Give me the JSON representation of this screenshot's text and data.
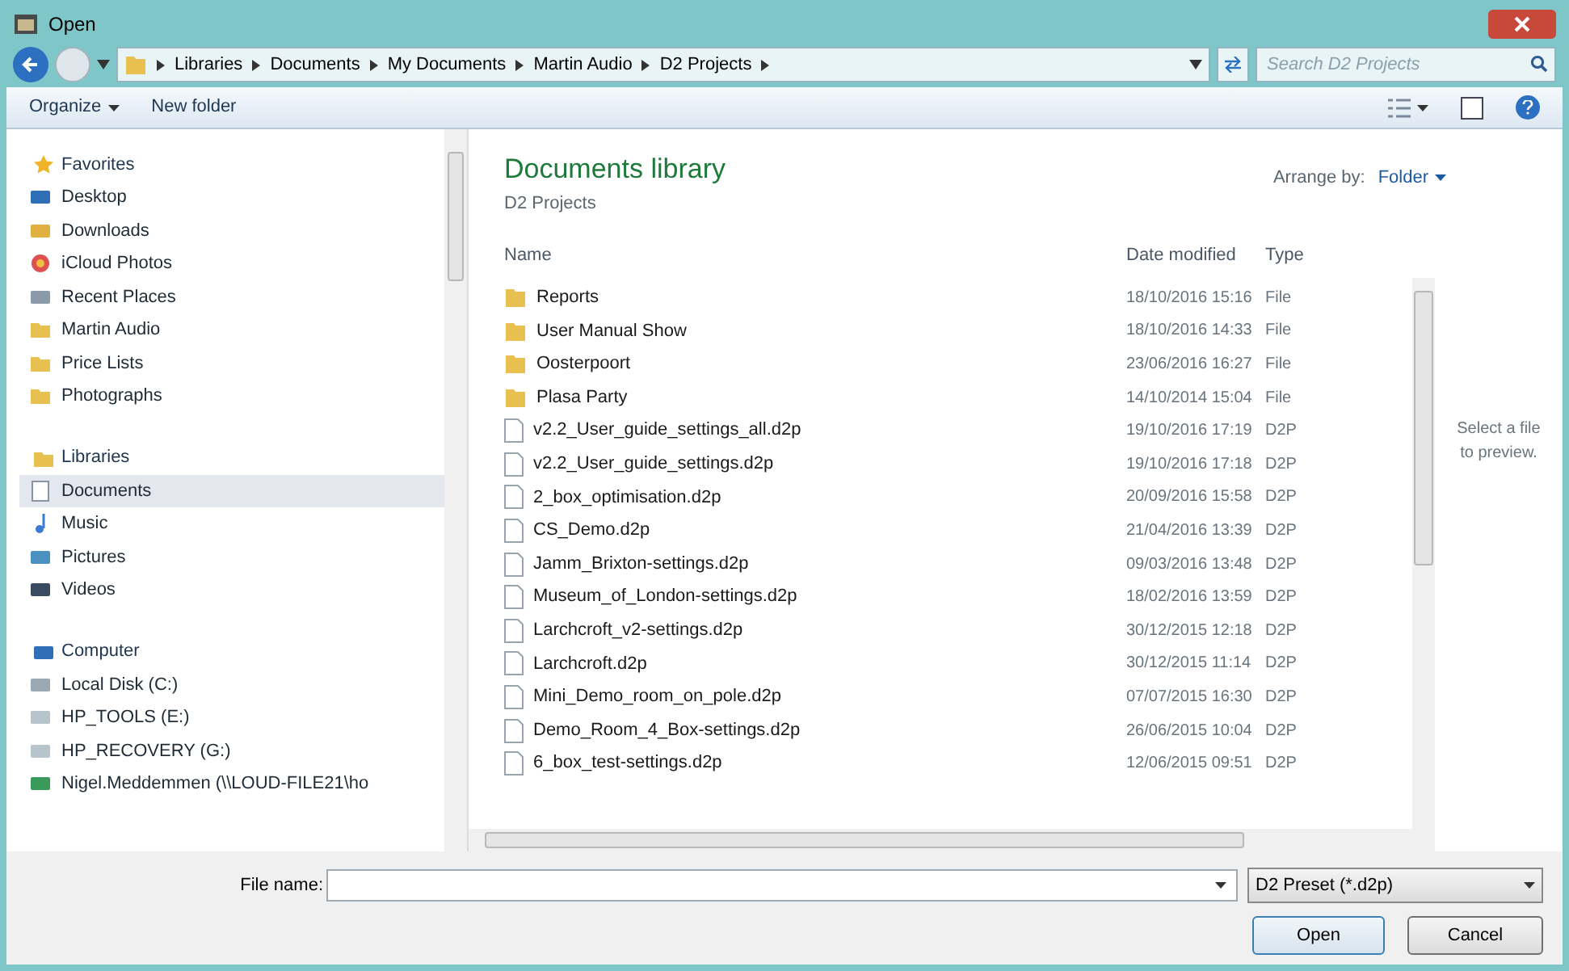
{
  "window": {
    "title": "Open"
  },
  "address": {
    "crumbs": [
      "Libraries",
      "Documents",
      "My Documents",
      "Martin Audio",
      "D2 Projects"
    ],
    "search_placeholder": "Search D2 Projects"
  },
  "toolbar": {
    "organize": "Organize",
    "new_folder": "New folder"
  },
  "sidebar": {
    "groups": [
      {
        "label": "Favorites",
        "kind": "star",
        "items": [
          {
            "label": "Desktop",
            "kind": "desktop",
            "selected": false
          },
          {
            "label": "Downloads",
            "kind": "download",
            "selected": false
          },
          {
            "label": "iCloud Photos",
            "kind": "photos",
            "selected": false
          },
          {
            "label": "Recent Places",
            "kind": "recent",
            "selected": false
          },
          {
            "label": "Martin Audio",
            "kind": "folder",
            "selected": false
          },
          {
            "label": "Price Lists",
            "kind": "folder",
            "selected": false
          },
          {
            "label": "Photographs",
            "kind": "folder",
            "selected": false
          }
        ]
      },
      {
        "label": "Libraries",
        "kind": "library",
        "items": [
          {
            "label": "Documents",
            "kind": "document",
            "selected": true
          },
          {
            "label": "Music",
            "kind": "music",
            "selected": false
          },
          {
            "label": "Pictures",
            "kind": "pictures",
            "selected": false
          },
          {
            "label": "Videos",
            "kind": "videos",
            "selected": false
          }
        ]
      },
      {
        "label": "Computer",
        "kind": "computer",
        "items": [
          {
            "label": "Local Disk (C:)",
            "kind": "disk",
            "selected": false
          },
          {
            "label": "HP_TOOLS (E:)",
            "kind": "drive",
            "selected": false
          },
          {
            "label": "HP_RECOVERY (G:)",
            "kind": "drive",
            "selected": false
          },
          {
            "label": "Nigel.Meddemmen (\\\\LOUD-FILE21\\ho",
            "kind": "network",
            "selected": false
          }
        ]
      }
    ]
  },
  "library": {
    "title": "Documents library",
    "subtitle": "D2 Projects",
    "arrange_label": "Arrange by:",
    "arrange_value": "Folder"
  },
  "table": {
    "columns": [
      "Name",
      "Date modified",
      "Type"
    ],
    "rows": [
      {
        "kind": "folder",
        "name": "Reports",
        "date": "18/10/2016 15:16",
        "type": "File"
      },
      {
        "kind": "folder",
        "name": "User Manual Show",
        "date": "18/10/2016 14:33",
        "type": "File"
      },
      {
        "kind": "folder",
        "name": "Oosterpoort",
        "date": "23/06/2016 16:27",
        "type": "File"
      },
      {
        "kind": "folder",
        "name": "Plasa Party",
        "date": "14/10/2014 15:04",
        "type": "File"
      },
      {
        "kind": "file",
        "name": "v2.2_User_guide_settings_all.d2p",
        "date": "19/10/2016 17:19",
        "type": "D2P"
      },
      {
        "kind": "file",
        "name": "v2.2_User_guide_settings.d2p",
        "date": "19/10/2016 17:18",
        "type": "D2P"
      },
      {
        "kind": "file",
        "name": "2_box_optimisation.d2p",
        "date": "20/09/2016 15:58",
        "type": "D2P"
      },
      {
        "kind": "file",
        "name": "CS_Demo.d2p",
        "date": "21/04/2016 13:39",
        "type": "D2P"
      },
      {
        "kind": "file",
        "name": "Jamm_Brixton-settings.d2p",
        "date": "09/03/2016 13:48",
        "type": "D2P"
      },
      {
        "kind": "file",
        "name": "Museum_of_London-settings.d2p",
        "date": "18/02/2016 13:59",
        "type": "D2P"
      },
      {
        "kind": "file",
        "name": "Larchcroft_v2-settings.d2p",
        "date": "30/12/2015 12:18",
        "type": "D2P"
      },
      {
        "kind": "file",
        "name": "Larchcroft.d2p",
        "date": "30/12/2015 11:14",
        "type": "D2P"
      },
      {
        "kind": "file",
        "name": "Mini_Demo_room_on_pole.d2p",
        "date": "07/07/2015 16:30",
        "type": "D2P"
      },
      {
        "kind": "file",
        "name": "Demo_Room_4_Box-settings.d2p",
        "date": "26/06/2015 10:04",
        "type": "D2P"
      },
      {
        "kind": "file",
        "name": "6_box_test-settings.d2p",
        "date": "12/06/2015 09:51",
        "type": "D2P"
      }
    ]
  },
  "preview": {
    "message": "Select a file to preview."
  },
  "footer": {
    "file_name_label": "File name:",
    "file_type": "D2 Preset (*.d2p)",
    "open": "Open",
    "cancel": "Cancel"
  }
}
